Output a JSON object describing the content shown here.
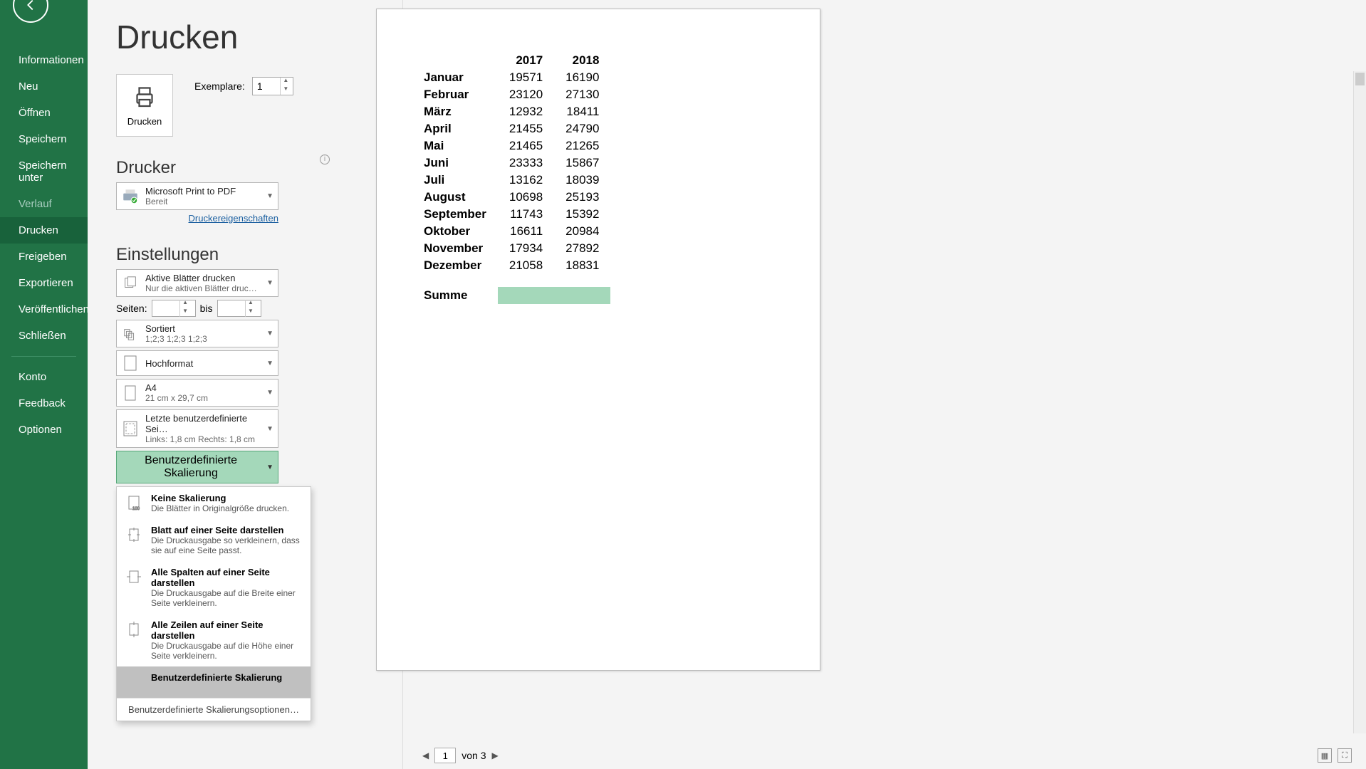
{
  "sidebar": {
    "items": [
      {
        "label": "Informationen"
      },
      {
        "label": "Neu"
      },
      {
        "label": "Öffnen"
      },
      {
        "label": "Speichern"
      },
      {
        "label": "Speichern unter"
      },
      {
        "label": "Verlauf",
        "disabled": true
      },
      {
        "label": "Drucken",
        "active": true
      },
      {
        "label": "Freigeben"
      },
      {
        "label": "Exportieren"
      },
      {
        "label": "Veröffentlichen"
      },
      {
        "label": "Schließen"
      }
    ],
    "footer": [
      {
        "label": "Konto"
      },
      {
        "label": "Feedback"
      },
      {
        "label": "Optionen"
      }
    ]
  },
  "title": "Drucken",
  "print_button": "Drucken",
  "copies": {
    "label": "Exemplare:",
    "value": "1"
  },
  "printer": {
    "heading": "Drucker",
    "name": "Microsoft Print to PDF",
    "status": "Bereit",
    "props_link": "Druckereigenschaften"
  },
  "settings": {
    "heading": "Einstellungen",
    "scope": {
      "title": "Aktive Blätter drucken",
      "sub": "Nur die aktiven Blätter druc…"
    },
    "pages": {
      "label": "Seiten:",
      "to": "bis"
    },
    "collate": {
      "title": "Sortiert",
      "sub": "1;2;3    1;2;3    1;2;3"
    },
    "orientation": {
      "title": "Hochformat"
    },
    "paper": {
      "title": "A4",
      "sub": "21 cm x 29,7 cm"
    },
    "margins": {
      "title": "Letzte benutzerdefinierte Sei…",
      "sub": "Links: 1,8 cm   Rechts: 1,8 cm"
    },
    "scaling_selected": "Benutzerdefinierte Skalierung",
    "scaling_menu": [
      {
        "title": "Keine Skalierung",
        "sub": "Die Blätter in Originalgröße drucken."
      },
      {
        "title": "Blatt auf einer Seite darstellen",
        "sub": "Die Druckausgabe so verkleinern, dass sie auf eine Seite passt."
      },
      {
        "title": "Alle Spalten auf einer Seite darstellen",
        "sub": "Die Druckausgabe auf die Breite einer Seite verkleinern."
      },
      {
        "title": "Alle Zeilen auf einer Seite darstellen",
        "sub": "Die Druckausgabe auf die Höhe einer Seite verkleinern."
      },
      {
        "title": "Benutzerdefinierte Skalierung"
      }
    ],
    "scaling_footer": "Benutzerdefinierte Skalierungsoptionen…"
  },
  "chart_data": {
    "type": "table",
    "title": "",
    "columns": [
      "",
      "2017",
      "2018"
    ],
    "rows": [
      [
        "Januar",
        19571,
        16190
      ],
      [
        "Februar",
        23120,
        27130
      ],
      [
        "März",
        12932,
        18411
      ],
      [
        "April",
        21455,
        24790
      ],
      [
        "Mai",
        21465,
        21265
      ],
      [
        "Juni",
        23333,
        15867
      ],
      [
        "Juli",
        13162,
        18039
      ],
      [
        "August",
        10698,
        25193
      ],
      [
        "September",
        11743,
        15392
      ],
      [
        "Oktober",
        16611,
        20984
      ],
      [
        "November",
        17934,
        27892
      ],
      [
        "Dezember",
        21058,
        18831
      ]
    ],
    "sum_label": "Summe"
  },
  "footer_nav": {
    "page": "1",
    "of": "von 3"
  }
}
